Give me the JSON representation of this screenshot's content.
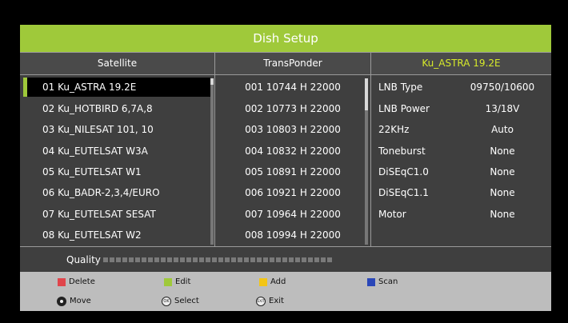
{
  "title": "Dish Setup",
  "headers": {
    "satellite": "Satellite",
    "transponder": "TransPonder",
    "selected_satellite": "Ku_ASTRA 19.2E"
  },
  "satellites": [
    "01 Ku_ASTRA 19.2E",
    "02 Ku_HOTBIRD 6,7A,8",
    "03 Ku_NILESAT 101, 10",
    "04 Ku_EUTELSAT W3A",
    "05 Ku_EUTELSAT W1",
    "06 Ku_BADR-2,3,4/EURO",
    "07 Ku_EUTELSAT SESAT",
    "08 Ku_EUTELSAT W2"
  ],
  "transponders": [
    "001 10744 H 22000",
    "002 10773 H 22000",
    "003 10803 H 22000",
    "004 10832 H 22000",
    "005 10891 H 22000",
    "006 10921 H 22000",
    "007 10964 H 22000",
    "008 10994 H 22000"
  ],
  "params": [
    {
      "label": "LNB Type",
      "value": "09750/10600"
    },
    {
      "label": "LNB Power",
      "value": "13/18V"
    },
    {
      "label": "22KHz",
      "value": "Auto"
    },
    {
      "label": "Toneburst",
      "value": "None"
    },
    {
      "label": "DiSEqC1.0",
      "value": "None"
    },
    {
      "label": "DiSEqC1.1",
      "value": "None"
    },
    {
      "label": "Motor",
      "value": "None"
    }
  ],
  "quality": {
    "label": "Quality",
    "level": 0
  },
  "footer": {
    "delete": "Delete",
    "edit": "Edit",
    "add": "Add",
    "scan": "Scan",
    "move": "Move",
    "select": "Select",
    "exit": "Exit",
    "ok_glyph": "OK",
    "exit_glyph": "EXIT"
  },
  "colors": {
    "accent": "#9fc93a",
    "delete": "#e0454b",
    "edit": "#9fc93a",
    "add": "#f3c515",
    "scan": "#2a47b8"
  }
}
